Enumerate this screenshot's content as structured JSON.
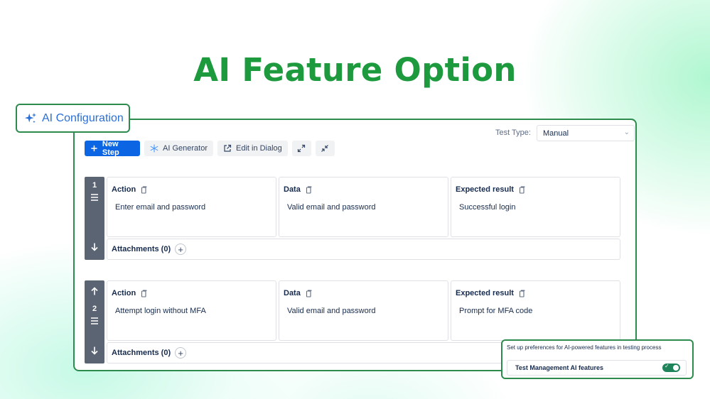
{
  "headline": "AI Feature Option",
  "ai_config_label": "AI Configuration",
  "test_type": {
    "label": "Test Type:",
    "value": "Manual"
  },
  "toolbar": {
    "new_step": "New Step",
    "ai_generator": "AI Generator",
    "edit_in_dialog": "Edit in Dialog"
  },
  "steps": [
    {
      "number": "1",
      "action": {
        "header": "Action",
        "value": "Enter email and password"
      },
      "data": {
        "header": "Data",
        "value": "Valid email and password"
      },
      "expected": {
        "header": "Expected result",
        "value": "Successful login"
      },
      "attachments": "Attachments (0)"
    },
    {
      "number": "2",
      "action": {
        "header": "Action",
        "value": "Attempt login without MFA"
      },
      "data": {
        "header": "Data",
        "value": "Valid email and password"
      },
      "expected": {
        "header": "Expected result",
        "value": "Prompt for MFA code"
      },
      "attachments": "Attachments (0)"
    }
  ],
  "ai_preferences": {
    "description": "Set up preferences for AI-powered features in testing process",
    "toggle_label": "Test Management AI features",
    "toggle_on": true
  },
  "colors": {
    "accent": "#1d9a3e",
    "primary_button": "#0c66e4",
    "frame": "#2e8b4e",
    "rail": "#5a6473"
  }
}
